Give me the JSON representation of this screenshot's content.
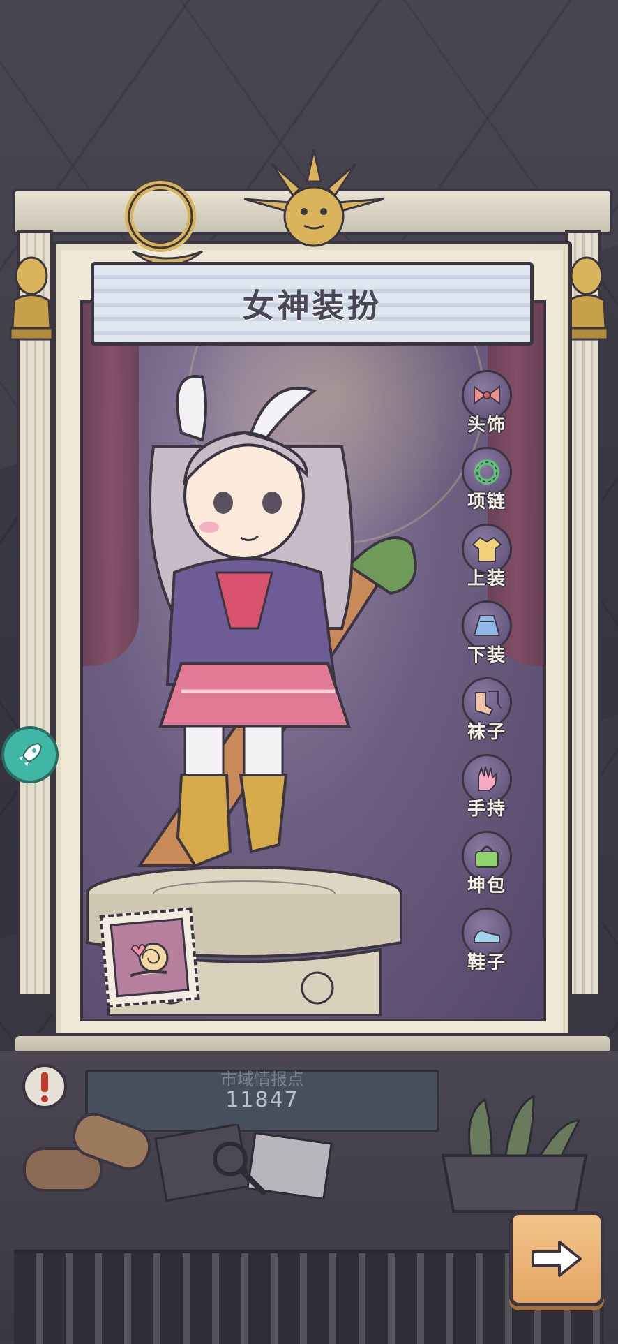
{
  "title": "女神装扮",
  "categories": [
    {
      "label": "头饰",
      "icon": "hair-bow-icon"
    },
    {
      "label": "项链",
      "icon": "necklace-icon"
    },
    {
      "label": "上装",
      "icon": "top-clothing-icon"
    },
    {
      "label": "下装",
      "icon": "skirt-icon"
    },
    {
      "label": "袜子",
      "icon": "socks-icon"
    },
    {
      "label": "手持",
      "icon": "glove-icon"
    },
    {
      "label": "坤包",
      "icon": "handbag-icon"
    },
    {
      "label": "鞋子",
      "icon": "shoes-icon"
    }
  ],
  "info_plate": {
    "label": "市域情报点",
    "value": "11847"
  },
  "colors": {
    "stage": "#6d5f82",
    "frame": "#efe9d8",
    "title_banner": "#dfe6f0",
    "next_button": "#f3c38a",
    "rocket_button": "#3fb7a4"
  }
}
